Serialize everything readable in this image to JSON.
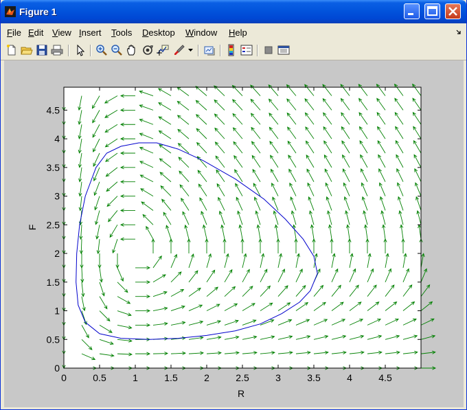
{
  "window": {
    "title": "Figure 1",
    "controls": [
      "minimize",
      "maximize",
      "close"
    ]
  },
  "menu": [
    "File",
    "Edit",
    "View",
    "Insert",
    "Tools",
    "Desktop",
    "Window",
    "Help"
  ],
  "menu_mnemonics": [
    "F",
    "E",
    "V",
    "I",
    "T",
    "D",
    "W",
    "H"
  ],
  "toolbar": {
    "tools": [
      "new-figure-icon",
      "open-file-icon",
      "save-icon",
      "print-icon",
      "pointer-icon",
      "zoom-in-icon",
      "zoom-out-icon",
      "pan-icon",
      "rotate-3d-icon",
      "data-cursor-icon",
      "brush-icon",
      "brush-dropdown-icon",
      "link-plot-icon",
      "colorbar-icon",
      "legend-icon",
      "hide-plot-tools-icon",
      "show-plot-tools-icon"
    ]
  },
  "chart_data": {
    "type": "quiver",
    "title": "",
    "xlabel": "R",
    "ylabel": "F",
    "xlim": [
      0,
      5
    ],
    "ylim": [
      0,
      4.9
    ],
    "xticks": [
      0,
      0.5,
      1,
      1.5,
      2,
      2.5,
      3,
      3.5,
      4,
      4.5
    ],
    "xtick_labels": [
      "0",
      "0.5",
      "1",
      "1.5",
      "2",
      "2.5",
      "3",
      "3.5",
      "4",
      "4.5"
    ],
    "yticks": [
      0,
      0.5,
      1,
      1.5,
      2,
      2.5,
      3,
      3.5,
      4,
      4.5
    ],
    "ytick_labels": [
      "0",
      "0.5",
      "1",
      "1.5",
      "2",
      "2.5",
      "3",
      "3.5",
      "4",
      "4.5"
    ],
    "vector_field": {
      "color": "#008000",
      "grid_x": [
        0,
        0.25,
        0.5,
        0.75,
        1,
        1.25,
        1.5,
        1.75,
        2,
        2.25,
        2.5,
        2.75,
        3,
        3.25,
        3.5,
        3.75,
        4,
        4.25,
        4.5,
        4.75,
        5
      ],
      "grid_y": [
        0,
        0.25,
        0.5,
        0.75,
        1,
        1.25,
        1.5,
        1.75,
        2,
        2.25,
        2.5,
        2.75,
        3,
        3.25,
        3.5,
        3.75,
        4,
        4.25,
        4.5,
        4.75
      ],
      "model": "dR/dt = R(2 - F), dF/dt = F(R - 1), unit-length arrows"
    },
    "trajectory": {
      "color": "#0000cc",
      "points": [
        [
          1.2,
          0.5
        ],
        [
          1.6,
          0.52
        ],
        [
          2.0,
          0.57
        ],
        [
          2.4,
          0.65
        ],
        [
          2.75,
          0.77
        ],
        [
          3.05,
          0.95
        ],
        [
          3.3,
          1.15
        ],
        [
          3.45,
          1.35
        ],
        [
          3.55,
          1.65
        ],
        [
          3.5,
          1.95
        ],
        [
          3.35,
          2.25
        ],
        [
          3.1,
          2.6
        ],
        [
          2.8,
          2.95
        ],
        [
          2.4,
          3.3
        ],
        [
          1.95,
          3.62
        ],
        [
          1.6,
          3.82
        ],
        [
          1.3,
          3.93
        ],
        [
          1.05,
          3.93
        ],
        [
          0.8,
          3.87
        ],
        [
          0.6,
          3.75
        ],
        [
          0.45,
          3.5
        ],
        [
          0.3,
          3.0
        ],
        [
          0.22,
          2.5
        ],
        [
          0.18,
          2.0
        ],
        [
          0.17,
          1.5
        ],
        [
          0.2,
          1.1
        ],
        [
          0.3,
          0.8
        ],
        [
          0.5,
          0.6
        ],
        [
          0.8,
          0.52
        ],
        [
          1.2,
          0.5
        ]
      ]
    }
  }
}
